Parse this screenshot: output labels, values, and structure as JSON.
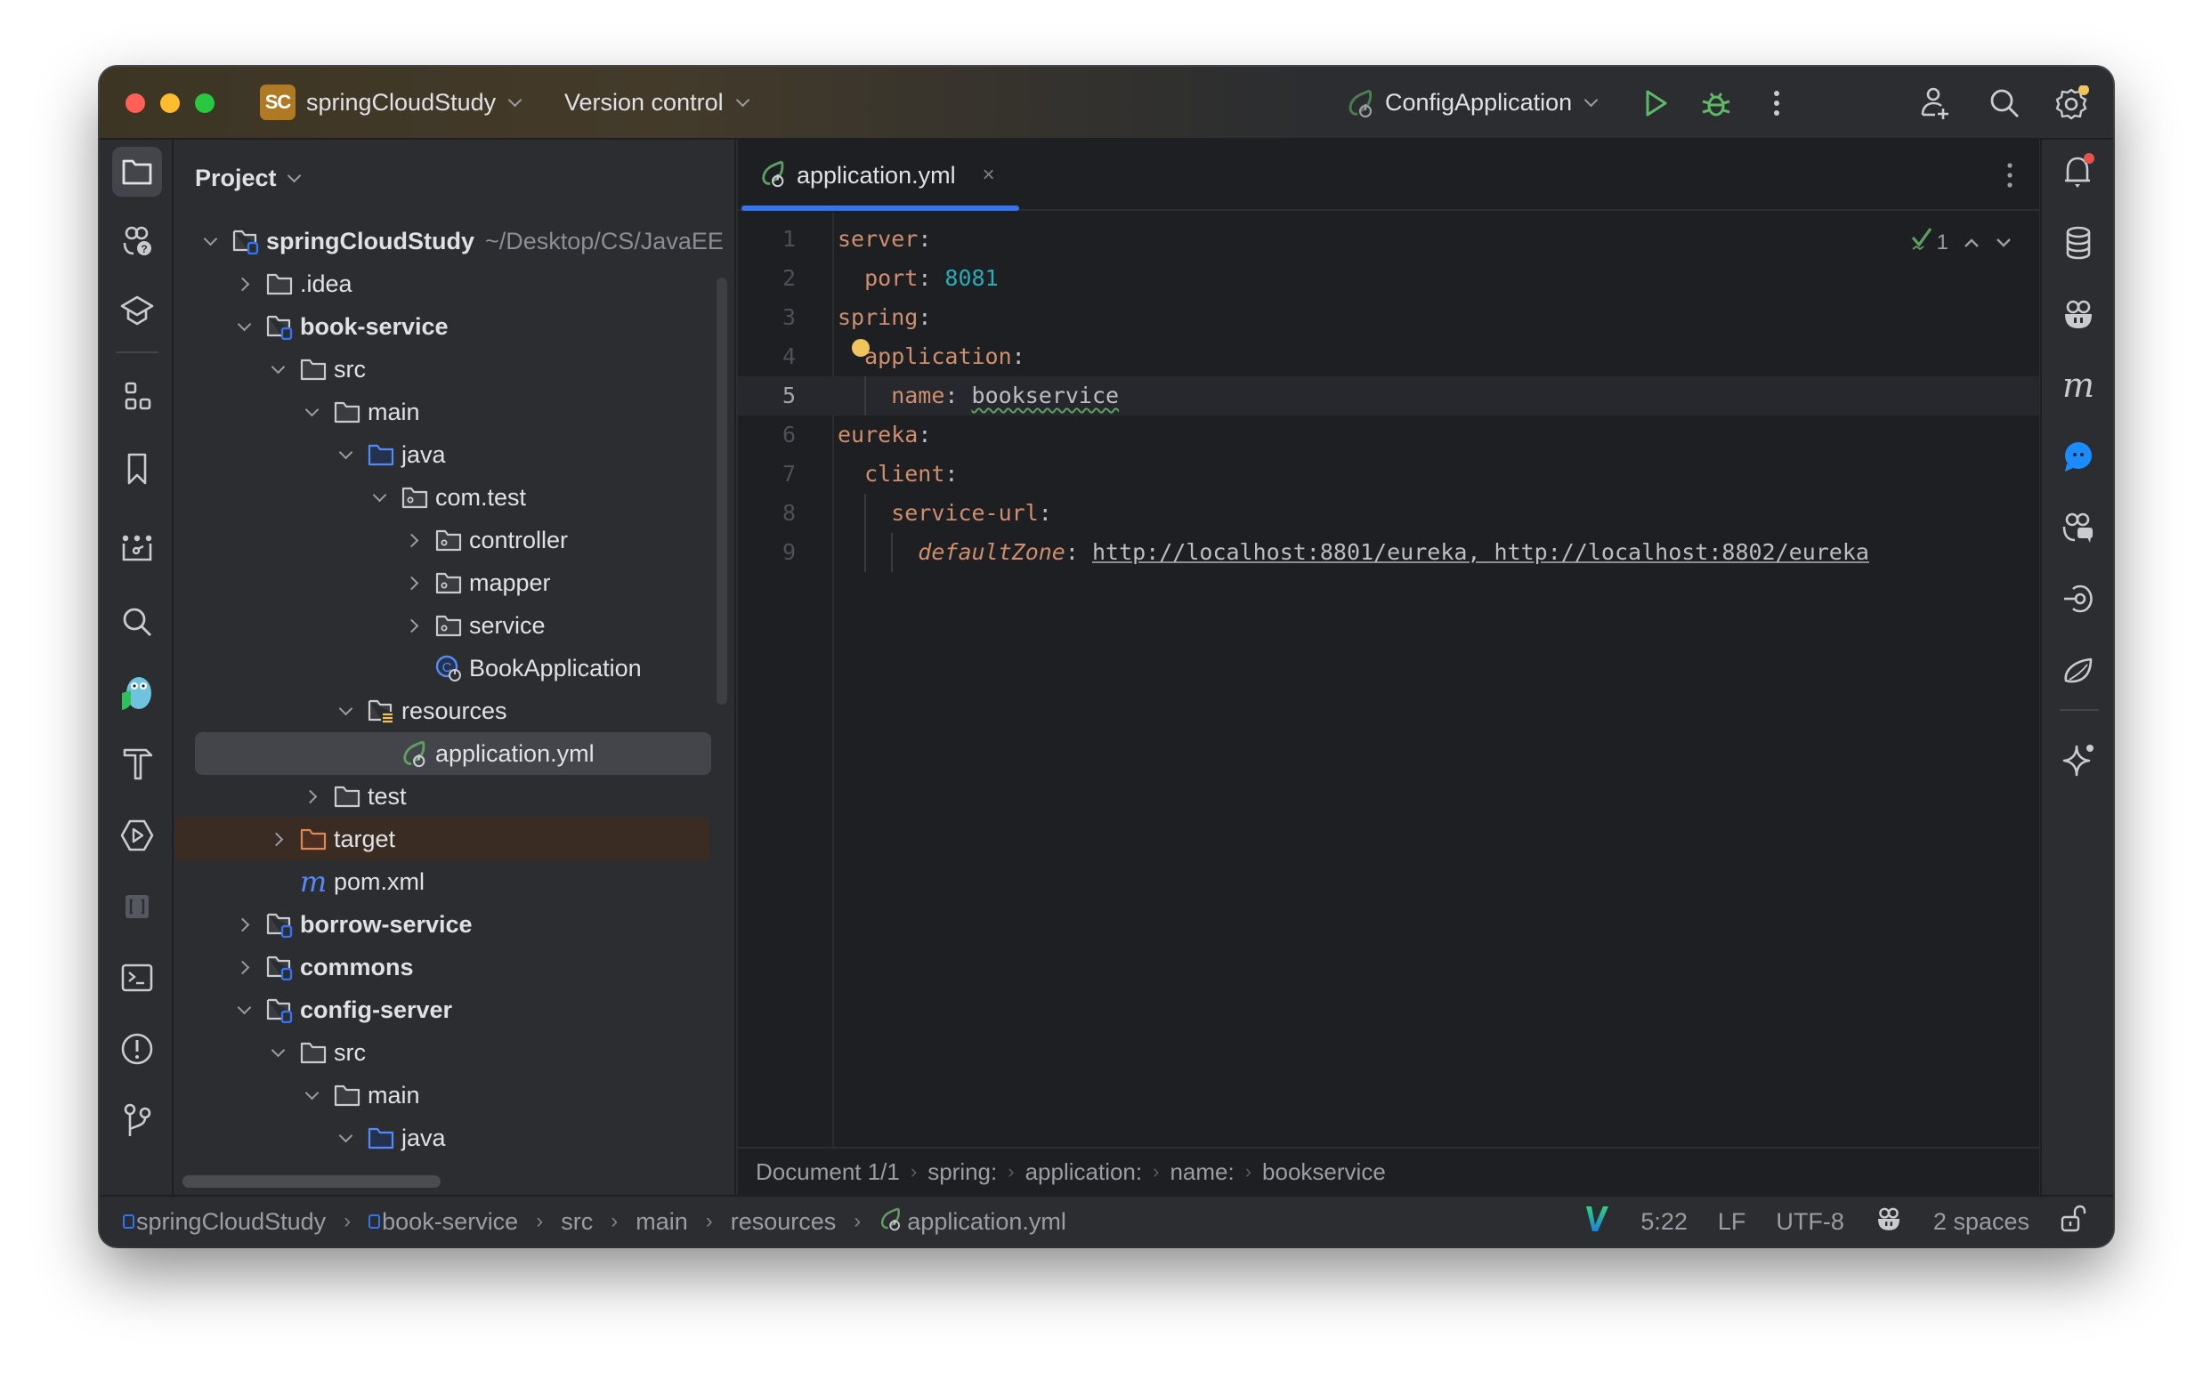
{
  "titlebar": {
    "project_badge": "SC",
    "project_name": "springCloudStudy",
    "version_control": "Version control",
    "run_config": "ConfigApplication"
  },
  "project_panel": {
    "title": "Project",
    "tree": [
      {
        "label": "springCloudStudy",
        "path": "~/Desktop/CS/JavaEE",
        "depth": 0,
        "expanded": true,
        "icon": "module-folder-icon",
        "bold": true
      },
      {
        "label": ".idea",
        "depth": 1,
        "expanded": false,
        "icon": "folder-icon"
      },
      {
        "label": "book-service",
        "depth": 1,
        "expanded": true,
        "icon": "module-folder-icon",
        "bold": true
      },
      {
        "label": "src",
        "depth": 2,
        "expanded": true,
        "icon": "folder-icon"
      },
      {
        "label": "main",
        "depth": 3,
        "expanded": true,
        "icon": "folder-icon"
      },
      {
        "label": "java",
        "depth": 4,
        "expanded": true,
        "icon": "source-folder-icon"
      },
      {
        "label": "com.test",
        "depth": 5,
        "expanded": true,
        "icon": "package-icon"
      },
      {
        "label": "controller",
        "depth": 6,
        "expanded": false,
        "icon": "package-icon"
      },
      {
        "label": "mapper",
        "depth": 6,
        "expanded": false,
        "icon": "package-icon"
      },
      {
        "label": "service",
        "depth": 6,
        "expanded": false,
        "icon": "package-icon"
      },
      {
        "label": "BookApplication",
        "depth": 6,
        "icon": "spring-class-icon"
      },
      {
        "label": "resources",
        "depth": 4,
        "expanded": true,
        "icon": "resources-folder-icon"
      },
      {
        "label": "application.yml",
        "depth": 5,
        "icon": "spring-config-icon",
        "selected": true
      },
      {
        "label": "test",
        "depth": 3,
        "expanded": false,
        "icon": "folder-icon"
      },
      {
        "label": "target",
        "depth": 2,
        "expanded": false,
        "icon": "excluded-folder-icon",
        "excluded": true
      },
      {
        "label": "pom.xml",
        "depth": 2,
        "icon": "maven-icon"
      },
      {
        "label": "borrow-service",
        "depth": 1,
        "expanded": false,
        "icon": "module-folder-icon",
        "bold": true
      },
      {
        "label": "commons",
        "depth": 1,
        "expanded": false,
        "icon": "module-folder-icon",
        "bold": true
      },
      {
        "label": "config-server",
        "depth": 1,
        "expanded": true,
        "icon": "module-folder-icon",
        "bold": true
      },
      {
        "label": "src",
        "depth": 2,
        "expanded": true,
        "icon": "folder-icon"
      },
      {
        "label": "main",
        "depth": 3,
        "expanded": true,
        "icon": "folder-icon"
      },
      {
        "label": "java",
        "depth": 4,
        "expanded": true,
        "icon": "source-folder-icon"
      }
    ]
  },
  "editor": {
    "tab": {
      "name": "application.yml",
      "close": "×"
    },
    "inspection": {
      "count": "1"
    },
    "current_line": 5,
    "lines": [
      {
        "n": "1",
        "indent": 0,
        "key": "server",
        "colon": ":"
      },
      {
        "n": "2",
        "indent": 1,
        "key": "port",
        "colon": ": ",
        "value": "8081",
        "vtype": "number"
      },
      {
        "n": "3",
        "indent": 0,
        "key": "spring",
        "colon": ":"
      },
      {
        "n": "4",
        "indent": 1,
        "key": "application",
        "colon": ":"
      },
      {
        "n": "5",
        "indent": 2,
        "key": "name",
        "colon": ": ",
        "value": "bookservice",
        "vtype": "string"
      },
      {
        "n": "6",
        "indent": 0,
        "key": "eureka",
        "colon": ":"
      },
      {
        "n": "7",
        "indent": 1,
        "key": "client",
        "colon": ":"
      },
      {
        "n": "8",
        "indent": 2,
        "key": "service-url",
        "colon": ":"
      },
      {
        "n": "9",
        "indent": 3,
        "key": "defaultZone",
        "colon": ": ",
        "value": "http://localhost:8801/eureka, http://localhost:8802/eureka",
        "vtype": "url"
      }
    ],
    "breadcrumbs": [
      "Document 1/1",
      "spring:",
      "application:",
      "name:",
      "bookservice"
    ]
  },
  "statusbar": {
    "path": [
      "springCloudStudy",
      "book-service",
      "src",
      "main",
      "resources",
      "application.yml"
    ],
    "cursor": "5:22",
    "line_ending": "LF",
    "encoding": "UTF-8",
    "indent": "2 spaces"
  },
  "colors": {
    "accent": "#3574f0",
    "run_green": "#5fb865",
    "yaml_key": "#cf8e6d",
    "yaml_number": "#2aacb8",
    "notification_red": "#e5534b",
    "settings_dot": "#f2c55c"
  }
}
